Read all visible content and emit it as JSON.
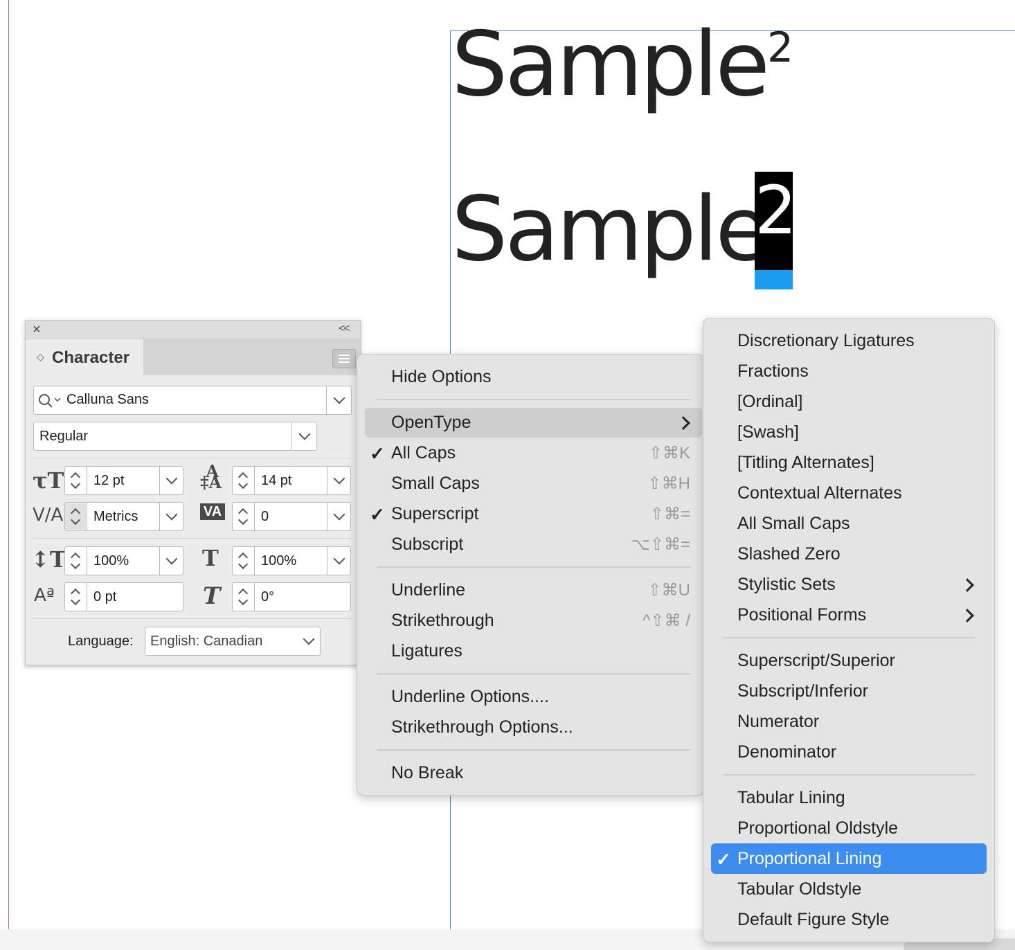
{
  "document": {
    "sample_line_1": "Sample",
    "sample_line_1_superscript": "2",
    "sample_line_2": "Sample",
    "sample_line_2_selected": "2"
  },
  "character_panel": {
    "close_glyph": "×",
    "collapse_glyph": "<<",
    "tab_arrows": "◇",
    "title": "Character",
    "font_family": "Calluna Sans",
    "font_style": "Regular",
    "font_size": "12 pt",
    "leading": "14 pt",
    "kerning": "Metrics",
    "tracking": "0",
    "vertical_scale": "100%",
    "horizontal_scale": "100%",
    "baseline_shift": "0 pt",
    "skew": "0°",
    "language_label": "Language:",
    "language": "English: Canadian"
  },
  "context_menu": {
    "items": [
      {
        "label": "Hide Options",
        "shortcut": ""
      },
      {
        "label": "OpenType",
        "shortcut": "",
        "submenu": true,
        "highlighted": true
      },
      {
        "label": "All Caps",
        "shortcut": "⇧⌘K",
        "checked": true
      },
      {
        "label": "Small Caps",
        "shortcut": "⇧⌘H"
      },
      {
        "label": "Superscript",
        "shortcut": "⇧⌘=",
        "checked": true
      },
      {
        "label": "Subscript",
        "shortcut": "⌥⇧⌘="
      },
      {
        "label": "Underline",
        "shortcut": "⇧⌘U"
      },
      {
        "label": "Strikethrough",
        "shortcut": "^⇧⌘ /"
      },
      {
        "label": "Ligatures",
        "shortcut": ""
      },
      {
        "label": "Underline Options....",
        "shortcut": ""
      },
      {
        "label": "Strikethrough Options...",
        "shortcut": ""
      },
      {
        "label": "No Break",
        "shortcut": ""
      }
    ],
    "check_glyph": "✓"
  },
  "opentype_submenu": {
    "items": [
      {
        "label": "Discretionary Ligatures"
      },
      {
        "label": "Fractions"
      },
      {
        "label": "[Ordinal]"
      },
      {
        "label": "[Swash]"
      },
      {
        "label": "[Titling Alternates]"
      },
      {
        "label": "Contextual Alternates"
      },
      {
        "label": "All Small Caps"
      },
      {
        "label": "Slashed Zero"
      },
      {
        "label": "Stylistic Sets",
        "submenu": true
      },
      {
        "label": "Positional Forms",
        "submenu": true
      },
      {
        "label": "Superscript/Superior"
      },
      {
        "label": "Subscript/Inferior"
      },
      {
        "label": "Numerator"
      },
      {
        "label": "Denominator"
      },
      {
        "label": "Tabular Lining"
      },
      {
        "label": "Proportional Oldstyle"
      },
      {
        "label": "Proportional Lining",
        "checked": true,
        "highlighted": true
      },
      {
        "label": "Tabular Oldstyle"
      },
      {
        "label": "Default Figure Style"
      }
    ],
    "highlight_color": "#3d8cf0"
  }
}
